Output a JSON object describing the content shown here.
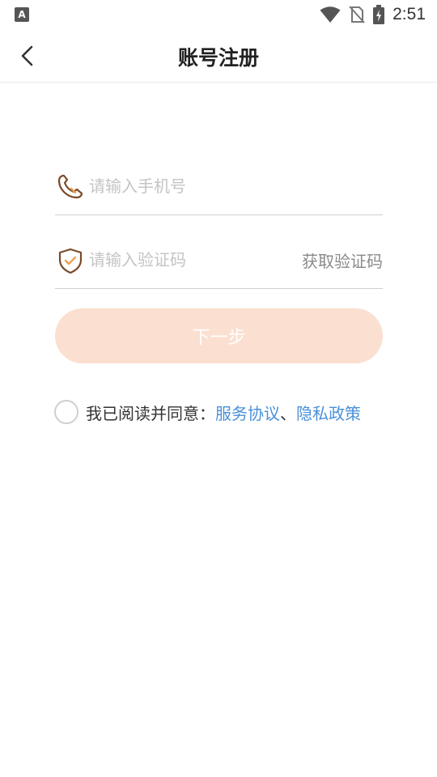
{
  "status_bar": {
    "time": "2:51",
    "app_badge": "A"
  },
  "nav": {
    "title": "账号注册"
  },
  "phone_field": {
    "placeholder": "请输入手机号",
    "value": ""
  },
  "code_field": {
    "placeholder": "请输入验证码",
    "value": "",
    "get_code_label": "获取验证码"
  },
  "next_button": {
    "label": "下一步"
  },
  "agreement": {
    "checked": false,
    "prefix": "我已阅读并同意：",
    "service_link": "服务协议",
    "separator": "、",
    "privacy_link": "隐私政策"
  },
  "colors": {
    "accent_light": "#fbdfd0",
    "icon_brown": "#7a4a2a",
    "icon_orange": "#f0a050",
    "link_blue": "#4a90d9"
  }
}
